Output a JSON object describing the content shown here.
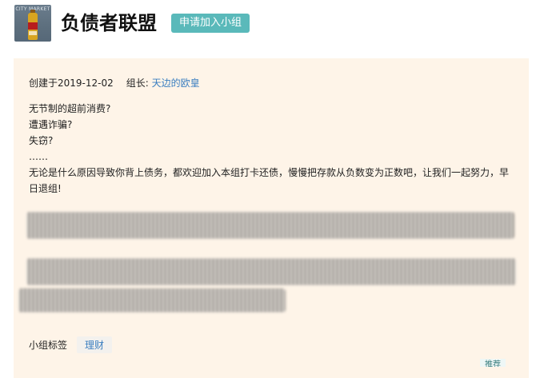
{
  "group": {
    "name": "负债者联盟",
    "join_label": "申请加入小组",
    "avatar_text": "CITY MARKET"
  },
  "meta": {
    "created": "创建于2019-12-02",
    "owner_label": "组长:",
    "owner_name": "天边的欧皇"
  },
  "intro": {
    "lines": [
      "无节制的超前消费?",
      "遭遇诈骗?",
      "失窃?",
      "……",
      "无论是什么原因导致你背上债务，都欢迎加入本组打卡还债，慢慢把存款从负数变为正数吧，让我们一起努力，早日退组!"
    ]
  },
  "tags": {
    "label": "小组标签",
    "items": [
      "理财"
    ]
  },
  "more_label": "推荐",
  "colors": {
    "accent": "#5ab9ba",
    "panel_bg": "#fef4e8",
    "link": "#3a7ec0"
  }
}
